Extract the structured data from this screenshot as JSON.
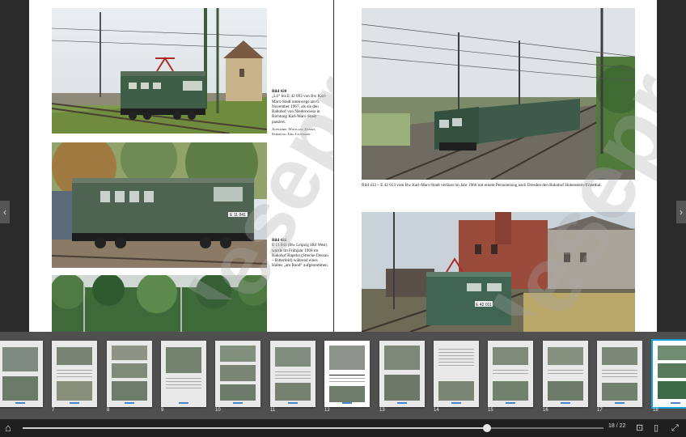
{
  "left_page": {
    "captions": [
      {
        "title": "Bild 430",
        "body": "„Lö“ bis E 42 093 von Bw Karl-Marx-Stadt unterwegs am 6. November 1967, als sie den Bahnhof von Niederwiesa in Richtung Karl-Marx-Stadt passiert.",
        "credit": "Aufnahme: Wolfgang Zeisert, Sammlung Jörg Leuthardt"
      },
      {
        "title": "Bild 431",
        "body": "E 11 041 (Bw Leipzig Hbf West) wurde im Frühjahr 1968 im Bahnhof Rapehn (Strecke Dessau – Bitterfeld) während eines Haltes „am Rand“ aufgenommen.",
        "credit": ""
      }
    ],
    "loco_number": "E 11 041"
  },
  "right_page": {
    "caption_top": "Bild 433 – E 42 013 vom Bw Karl-Marx-Stadt verlässt im Jahr 1966 mit einem Personenzug nach Dresden den Bahnhof Hohenstein-Ernstthal.",
    "loco_number": "E 42 011"
  },
  "watermark_text": "leseprobe",
  "thumbnails": {
    "page_numbers": [
      "",
      "7",
      "8",
      "9",
      "10",
      "11",
      "12",
      "13",
      "14",
      "15",
      "16",
      "17",
      "18"
    ]
  },
  "navigation": {
    "prev_icon": "chevron-left-icon",
    "next_icon": "chevron-right-icon",
    "prev_glyph": "‹",
    "next_glyph": "›"
  },
  "bottom_bar": {
    "home_icon": "home-icon",
    "home_glyph": "⌂",
    "page_indicator": "18 / 22",
    "progress": 0.8,
    "layout_icon": "single-page-icon",
    "expand_icon": "fullscreen-icon",
    "grid_glyph": "⊡",
    "layout_glyph": "▯",
    "expand_glyph": "⤢"
  },
  "colors": {
    "accent": "#19a0d8",
    "background": "#2b2b2b",
    "loco_green": "#3d5a44"
  }
}
